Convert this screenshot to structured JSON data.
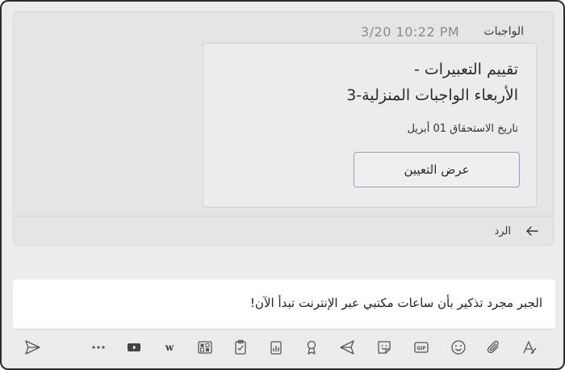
{
  "post": {
    "sender": "الواجبات",
    "timestamp": "3/20 10:22 PM"
  },
  "assignment_card": {
    "title_line1": "تقييم التعبيرات -",
    "title_line2": "الأربعاء الواجبات المنزلية-3",
    "due": "تاريخ الاستحقاق 01 أبريل",
    "view_button": "عرض التعيين"
  },
  "reply": {
    "label": "الرد"
  },
  "compose": {
    "text": "الجبر مجرد تذكير بأن ساعات مكتبي عبر الإنترنت تبدأ الآن!"
  },
  "toolbar": {
    "icons": [
      "send-icon",
      "more-icon",
      "video-icon",
      "word-icon",
      "forms-icon",
      "clipboard-icon",
      "poll-icon",
      "praise-icon",
      "send-arrow-icon",
      "sticker-icon",
      "gif-icon",
      "emoji-icon",
      "attach-icon",
      "format-icon"
    ]
  }
}
